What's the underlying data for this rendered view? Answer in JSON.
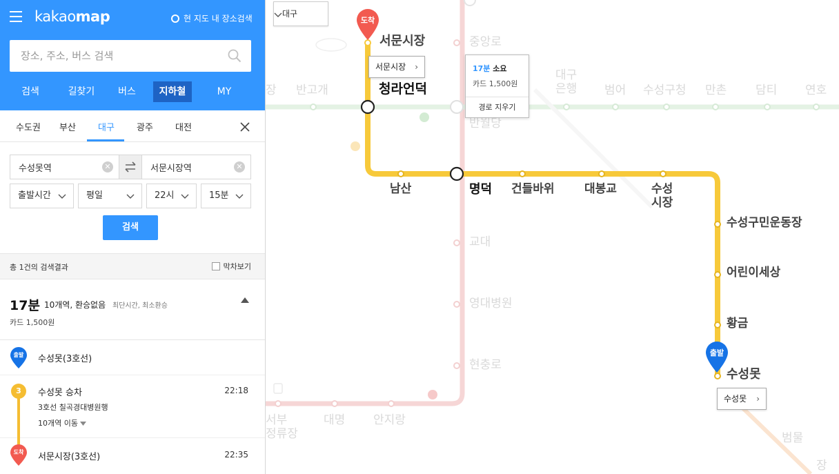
{
  "app": {
    "logo_light": "kakao",
    "logo_bold": "map",
    "local_search": "현 지도 내 장소검색"
  },
  "search": {
    "placeholder": "장소, 주소, 버스 검색"
  },
  "main_tabs": [
    "검색",
    "길찾기",
    "버스",
    "지하철",
    "MY"
  ],
  "main_tab_active": "지하철",
  "region_tabs": [
    "수도권",
    "부산",
    "대구",
    "광주",
    "대전"
  ],
  "region_active": "대구",
  "route": {
    "from": "수성못역",
    "to": "서문시장역"
  },
  "options": {
    "time_type": "출발시간",
    "day": "평일",
    "hour": "22시",
    "minute": "15분"
  },
  "search_button": "검색",
  "results": {
    "count_text": "총 1건의 검색결과",
    "last_train": "막차보기"
  },
  "summary": {
    "time": "17분",
    "desc": "10개역, 환승없음",
    "tags": "최단시간, 최소환승",
    "fare": "카드 1,500원"
  },
  "steps": {
    "start_badge": "출발",
    "start_station": "수성못(3호선)",
    "board_line": "3",
    "board_station": "수성못 승차",
    "board_time": "22:18",
    "direction": "3호선 칠곡경대병원행",
    "moves": "10개역 이동",
    "end_badge": "도착",
    "end_station": "서문시장(3호선)",
    "end_time": "22:35"
  },
  "map": {
    "city": "대구",
    "route_stations": {
      "seomun": "서문시장",
      "cheongna": "청라언덕",
      "namsan": "남산",
      "myeongdeok": "명덕",
      "geondeul": "건들바위",
      "daebong": "대봉교",
      "suseong_market": "수성\n시장",
      "suseong_sports": "수성구민운동장",
      "children": "어린이세상",
      "hwanggeum": "황금",
      "suseongmot": "수성못"
    },
    "faded_stations": {
      "jungangno": "중앙로",
      "bangogae": "반고개",
      "daegu_bank": "대구\n은행",
      "beomeo": "범어",
      "suseong_office": "수성구청",
      "manchon": "만촌",
      "damti": "담티",
      "yeonho": "연호",
      "banwoldang": "반월당",
      "gyodae": "교대",
      "yeungnam_hosp": "영대병원",
      "hyeonchungno": "현충로",
      "daemyeong": "대명",
      "anjirang": "안지랑",
      "seobu": "서부\n정류장",
      "beommul": "범물",
      "jang": "장"
    },
    "card_seomun": "서문시장",
    "card_suseongmot": "수성못",
    "popup": {
      "time": "17분",
      "suffix": " 소요",
      "fare": "카드 1,500원",
      "clear": "경로 지우기"
    },
    "pin_arrive": "도착",
    "pin_depart": "출발",
    "colors": {
      "line3": "#f7c93a",
      "line1": "#f6d6d6",
      "line2": "#e4f2e4",
      "brand": "#3396ff",
      "arrive_pin": "#f25a50",
      "depart_pin": "#1673e6"
    }
  }
}
